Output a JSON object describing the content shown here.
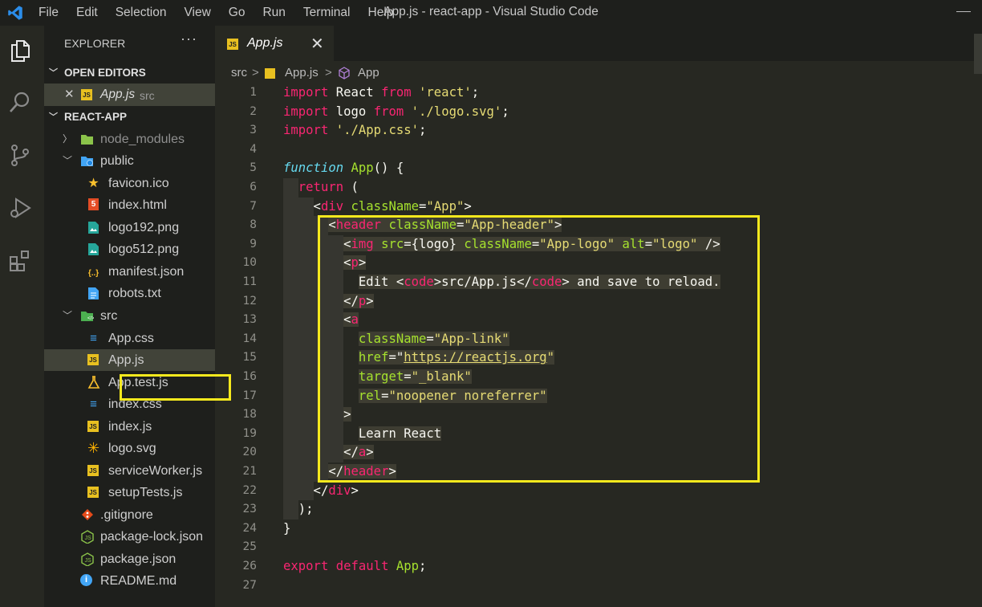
{
  "titlebar": {
    "menu": [
      "File",
      "Edit",
      "Selection",
      "View",
      "Go",
      "Run",
      "Terminal",
      "Help"
    ],
    "window_title": "App.js - react-app - Visual Studio Code"
  },
  "activity_icons": [
    "files-icon",
    "search-icon",
    "source-control-icon",
    "run-debug-icon",
    "extensions-icon"
  ],
  "sidebar": {
    "title": "EXPLORER",
    "more": "···",
    "open_editors": {
      "header": "OPEN EDITORS",
      "items": [
        {
          "close": "✕",
          "icon": "JS",
          "name": "App.js",
          "path": "src"
        }
      ]
    },
    "folder": {
      "header": "REACT-APP",
      "items": [
        {
          "name": "node_modules",
          "type": "folder",
          "state": "collapsed",
          "icon": "folder-node-icon",
          "dimmed": true
        },
        {
          "name": "public",
          "type": "folder",
          "state": "expanded",
          "icon": "folder-public-icon"
        },
        {
          "name": "favicon.ico",
          "type": "file",
          "icon": "star-icon"
        },
        {
          "name": "index.html",
          "type": "file",
          "icon": "html5-icon",
          "glyph": "5"
        },
        {
          "name": "logo192.png",
          "type": "file",
          "icon": "image-icon"
        },
        {
          "name": "logo512.png",
          "type": "file",
          "icon": "image-icon"
        },
        {
          "name": "manifest.json",
          "type": "file",
          "icon": "json-icon",
          "glyph": "{..}"
        },
        {
          "name": "robots.txt",
          "type": "file",
          "icon": "text-file-icon"
        },
        {
          "name": "src",
          "type": "folder",
          "state": "expanded",
          "icon": "folder-src-icon"
        },
        {
          "name": "App.css",
          "type": "file",
          "icon": "css-icon"
        },
        {
          "name": "App.js",
          "type": "file",
          "icon": "js-icon",
          "glyph": "JS",
          "selected": true
        },
        {
          "name": "App.test.js",
          "type": "file",
          "icon": "flask-icon"
        },
        {
          "name": "index.css",
          "type": "file",
          "icon": "css-icon"
        },
        {
          "name": "index.js",
          "type": "file",
          "icon": "js-icon",
          "glyph": "JS"
        },
        {
          "name": "logo.svg",
          "type": "file",
          "icon": "react-svg-icon"
        },
        {
          "name": "serviceWorker.js",
          "type": "file",
          "icon": "js-icon",
          "glyph": "JS"
        },
        {
          "name": "setupTests.js",
          "type": "file",
          "icon": "js-icon",
          "glyph": "JS"
        },
        {
          "name": ".gitignore",
          "type": "file",
          "icon": "git-icon"
        },
        {
          "name": "package-lock.json",
          "type": "file",
          "icon": "nodejs-icon"
        },
        {
          "name": "package.json",
          "type": "file",
          "icon": "nodejs-icon"
        },
        {
          "name": "README.md",
          "type": "file",
          "icon": "info-icon",
          "glyph": "i"
        }
      ]
    }
  },
  "tab": {
    "icon": "JS",
    "label": "App.js",
    "close": "✕"
  },
  "breadcrumb": {
    "folder": "src",
    "file": "App.js",
    "symbol": "App",
    "separator": ">"
  },
  "editor": {
    "lines": [
      [
        [
          "import",
          "kw"
        ],
        [
          " React ",
          ""
        ],
        [
          "from",
          "kw"
        ],
        [
          " ",
          ""
        ],
        [
          "'react'",
          "str"
        ],
        [
          ";",
          ""
        ]
      ],
      [
        [
          "import",
          "kw"
        ],
        [
          " logo ",
          ""
        ],
        [
          "from",
          "kw"
        ],
        [
          " ",
          ""
        ],
        [
          "'./logo.svg'",
          "str"
        ],
        [
          ";",
          ""
        ]
      ],
      [
        [
          "import",
          "kw"
        ],
        [
          " ",
          ""
        ],
        [
          "'./App.css'",
          "str"
        ],
        [
          ";",
          ""
        ]
      ],
      [],
      [
        [
          "function",
          "fnkw"
        ],
        [
          " ",
          ""
        ],
        [
          "App",
          "fn"
        ],
        [
          "() {",
          ""
        ]
      ],
      [
        [
          "  ",
          ""
        ],
        [
          "return",
          "kw"
        ],
        [
          " (",
          ""
        ]
      ],
      [
        [
          "    <",
          ""
        ],
        [
          "div",
          "tag"
        ],
        [
          " ",
          ""
        ],
        [
          "className",
          "attr"
        ],
        [
          "=",
          ""
        ],
        [
          "\"App\"",
          "str"
        ],
        [
          ">",
          ""
        ]
      ],
      [
        [
          "      <",
          ""
        ],
        [
          "header",
          "tag"
        ],
        [
          " ",
          ""
        ],
        [
          "className",
          "attr"
        ],
        [
          "=",
          ""
        ],
        [
          "\"App-header\"",
          "str"
        ],
        [
          ">",
          ""
        ]
      ],
      [
        [
          "        <",
          ""
        ],
        [
          "img",
          "tag"
        ],
        [
          " ",
          ""
        ],
        [
          "src",
          "attr"
        ],
        [
          "={",
          ""
        ],
        [
          "logo",
          ""
        ],
        [
          "} ",
          ""
        ],
        [
          "className",
          "attr"
        ],
        [
          "=",
          ""
        ],
        [
          "\"App-logo\"",
          "str"
        ],
        [
          " ",
          ""
        ],
        [
          "alt",
          "attr"
        ],
        [
          "=",
          ""
        ],
        [
          "\"logo\"",
          "str"
        ],
        [
          " />",
          ""
        ]
      ],
      [
        [
          "        <",
          ""
        ],
        [
          "p",
          "tag"
        ],
        [
          ">",
          ""
        ]
      ],
      [
        [
          "          Edit <",
          ""
        ],
        [
          "code",
          "tag"
        ],
        [
          ">src/App.js</",
          ""
        ],
        [
          "code",
          "tag"
        ],
        [
          "> and save to reload.",
          ""
        ]
      ],
      [
        [
          "        </",
          ""
        ],
        [
          "p",
          "tag"
        ],
        [
          ">",
          ""
        ]
      ],
      [
        [
          "        <",
          ""
        ],
        [
          "a",
          "tag"
        ]
      ],
      [
        [
          "          ",
          ""
        ],
        [
          "className",
          "attr"
        ],
        [
          "=",
          ""
        ],
        [
          "\"App-link\"",
          "str"
        ]
      ],
      [
        [
          "          ",
          ""
        ],
        [
          "href",
          "attr"
        ],
        [
          "=",
          ""
        ],
        [
          "\"",
          ""
        ],
        [
          "https://reactjs.org",
          "url str"
        ],
        [
          "\"",
          "str"
        ]
      ],
      [
        [
          "          ",
          ""
        ],
        [
          "target",
          "attr"
        ],
        [
          "=",
          ""
        ],
        [
          "\"_blank\"",
          "str"
        ]
      ],
      [
        [
          "          ",
          ""
        ],
        [
          "rel",
          "attr"
        ],
        [
          "=",
          ""
        ],
        [
          "\"noopener noreferrer\"",
          "str"
        ]
      ],
      [
        [
          "        >",
          ""
        ]
      ],
      [
        [
          "          Learn React",
          ""
        ]
      ],
      [
        [
          "        </",
          ""
        ],
        [
          "a",
          "tag"
        ],
        [
          ">",
          ""
        ]
      ],
      [
        [
          "      </",
          ""
        ],
        [
          "header",
          "tag"
        ],
        [
          ">",
          ""
        ]
      ],
      [
        [
          "    </",
          ""
        ],
        [
          "div",
          "tag"
        ],
        [
          ">",
          ""
        ]
      ],
      [
        [
          "  );",
          ""
        ]
      ],
      [
        [
          "}",
          ""
        ]
      ],
      [],
      [
        [
          "export",
          "kw"
        ],
        [
          " ",
          ""
        ],
        [
          "default",
          "kw"
        ],
        [
          " ",
          ""
        ],
        [
          "App",
          "fn"
        ],
        [
          ";",
          ""
        ]
      ],
      []
    ]
  },
  "colors": {
    "highlight_box": "#f6e91d",
    "editor_bg": "#272822",
    "sidebar_bg": "#1e1f1c"
  }
}
